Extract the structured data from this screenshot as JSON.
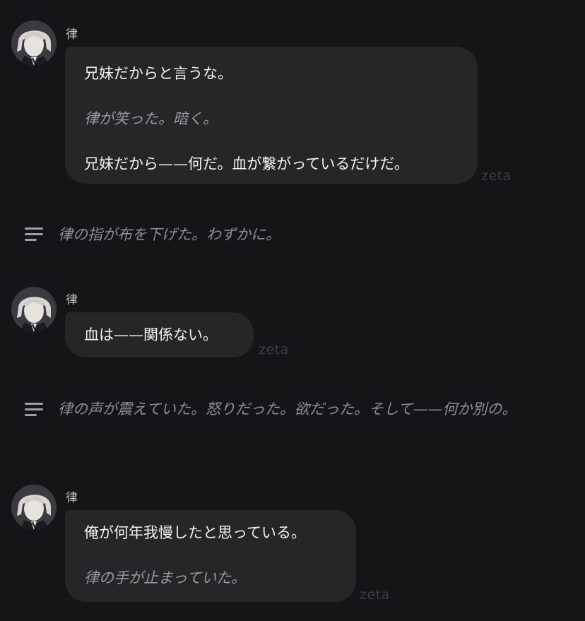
{
  "chat": {
    "messages": [
      {
        "sender": "律",
        "avatar_icon": "character-avatar-icon",
        "lines": [
          {
            "text": "兄妹だからと言うな。",
            "style": "normal"
          },
          {
            "text": "律が笑った。暗く。",
            "style": "italic"
          },
          {
            "text": "兄妹だから——何だ。血が繋がっているだけだ。",
            "style": "normal"
          }
        ],
        "watermark": "zeta"
      },
      {
        "sender": "律",
        "avatar_icon": "character-avatar-icon",
        "lines": [
          {
            "text": "血は——関係ない。",
            "style": "normal"
          }
        ],
        "watermark": "zeta"
      },
      {
        "sender": "律",
        "avatar_icon": "character-avatar-icon",
        "lines": [
          {
            "text": "俺が何年我慢したと思っている。",
            "style": "normal"
          },
          {
            "text": "律の手が止まっていた。",
            "style": "italic"
          }
        ],
        "watermark": "zeta"
      }
    ],
    "narrations": [
      {
        "icon": "narration-lines-icon",
        "text": "律の指が布を下げた。わずかに。"
      },
      {
        "icon": "narration-lines-icon",
        "text": "律の声が震えていた。怒りだった。欲だった。そして——何か別の。"
      }
    ]
  },
  "colors": {
    "background": "#151417",
    "bubble": "#262628",
    "text": "#f2f2f2",
    "italic_text": "#9a999d",
    "watermark": "#3d3c4a"
  }
}
